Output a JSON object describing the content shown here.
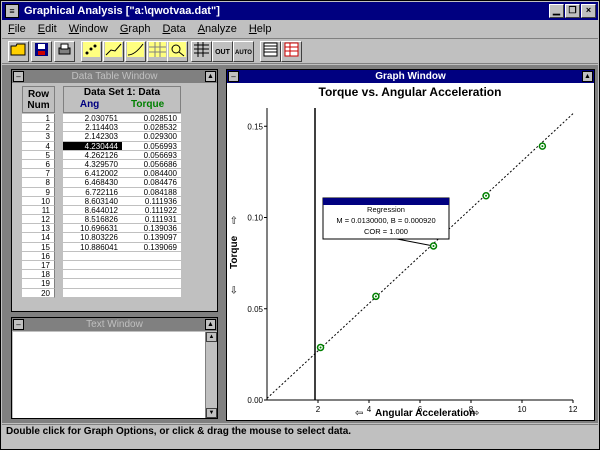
{
  "app": {
    "title": "Graphical Analysis [\"a:\\qwotvaa.dat\"]",
    "menu": [
      "File",
      "Edit",
      "Window",
      "Graph",
      "Data",
      "Analyze",
      "Help"
    ]
  },
  "toolbar": {
    "out_label": "OUT",
    "auto_label": "AUTO"
  },
  "data_table": {
    "title": "Data Table Window",
    "row_header": [
      "Row",
      "Num"
    ],
    "dataset_name": "Data Set 1: Data",
    "col1": "Ang",
    "col2": "Torque",
    "rows": [
      {
        "num": "1",
        "ang": "2.030751",
        "torque": "0.028510"
      },
      {
        "num": "2",
        "ang": "2.114403",
        "torque": "0.028532"
      },
      {
        "num": "3",
        "ang": "2.142303",
        "torque": "0.029300"
      },
      {
        "num": "4",
        "ang": "4.230444",
        "torque": "0.056993"
      },
      {
        "num": "5",
        "ang": "4.262126",
        "torque": "0.056693"
      },
      {
        "num": "6",
        "ang": "4.329570",
        "torque": "0.056686"
      },
      {
        "num": "7",
        "ang": "6.412002",
        "torque": "0.084400"
      },
      {
        "num": "8",
        "ang": "6.468430",
        "torque": "0.084476"
      },
      {
        "num": "9",
        "ang": "6.722116",
        "torque": "0.084188"
      },
      {
        "num": "10",
        "ang": "8.603140",
        "torque": "0.111936"
      },
      {
        "num": "11",
        "ang": "8.644012",
        "torque": "0.111922"
      },
      {
        "num": "12",
        "ang": "8.516826",
        "torque": "0.111931"
      },
      {
        "num": "13",
        "ang": "10.696631",
        "torque": "0.139036"
      },
      {
        "num": "14",
        "ang": "10.803226",
        "torque": "0.139097"
      },
      {
        "num": "15",
        "ang": "10.886041",
        "torque": "0.139069"
      },
      {
        "num": "16",
        "ang": "",
        "torque": ""
      },
      {
        "num": "17",
        "ang": "",
        "torque": ""
      },
      {
        "num": "18",
        "ang": "",
        "torque": ""
      },
      {
        "num": "19",
        "ang": "",
        "torque": ""
      },
      {
        "num": "20",
        "ang": "",
        "torque": ""
      }
    ],
    "selected_row": 4
  },
  "text_window": {
    "title": "Text Window"
  },
  "graph_window": {
    "title": "Graph Window"
  },
  "chart_data": {
    "type": "scatter",
    "title": "Torque vs. Angular Acceleration",
    "xlabel": "Angular Acceleration",
    "ylabel": "Torque",
    "xlim": [
      0,
      12
    ],
    "ylim": [
      0,
      0.16
    ],
    "xticks": [
      "2",
      "4",
      "6",
      "8",
      "10",
      "12"
    ],
    "yticks": [
      "0.00",
      "0.05",
      "0.10",
      "0.15"
    ],
    "points_x": [
      2.1,
      4.27,
      6.53,
      8.59,
      10.8
    ],
    "points_y": [
      0.0288,
      0.0568,
      0.0844,
      0.1119,
      0.1391
    ],
    "fit_line": {
      "slope": 0.013,
      "intercept": 0.0009
    },
    "annotation": {
      "title": "Regression",
      "line1": "M = 0.0130000, B = 0.000920",
      "line2": "COR = 1.000"
    }
  },
  "status": {
    "text": "Double click for Graph Options, or click & drag the mouse to select data."
  }
}
